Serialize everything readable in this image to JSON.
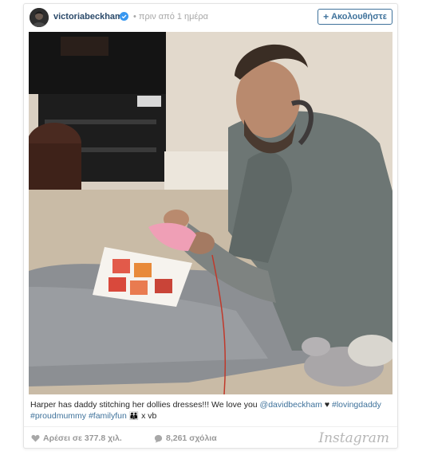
{
  "post": {
    "username": "victoriabeckham",
    "timestamp": "• πριν από 1 ημέρα",
    "follow_label": "Ακολουθήστε",
    "caption": {
      "text1": "Harper has daddy stitching her dollies dresses!!! We love you ",
      "mention": "@davidbeckham",
      "heart": " ♥ ",
      "tag1": "#lovingdaddy",
      "tag2": "#proudmummy",
      "tag3": "#familyfun",
      "text2": " x vb"
    },
    "likes": "Αρέσει σε 377.8 χιλ.",
    "comments": "8,261 σχόλια",
    "brand": "Instagram"
  },
  "colors": {
    "link": "#3f729b",
    "verified": "#3897f0",
    "muted": "#999999"
  },
  "icons": [
    "verified-badge-icon",
    "plus-icon",
    "heart-icon",
    "comment-icon"
  ]
}
